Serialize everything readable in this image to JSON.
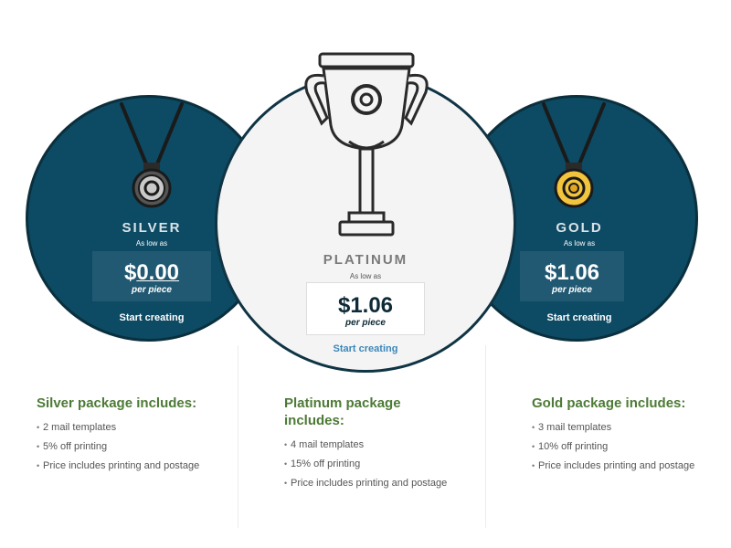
{
  "colors": {
    "side_circle": "#0d4a63",
    "center_circle": "#f5f4f4",
    "heading_green": "#4d7a36",
    "link_blue": "#3a87b9",
    "gold": "#f2c53c",
    "silver": "#c9c9c9"
  },
  "silver": {
    "name": "SILVER",
    "low": "As low as",
    "price_symbol": "$",
    "price_value": "0.00",
    "per": "per piece",
    "cta": "Start creating",
    "icon": "silver-medal-icon",
    "heading": "Silver package includes:",
    "features": [
      "2 mail templates",
      "5% off printing",
      "Price includes printing and postage"
    ]
  },
  "platinum": {
    "name": "PLATINUM",
    "low": "As low as",
    "price": "$1.06",
    "per": "per piece",
    "cta": "Start creating",
    "icon": "trophy-icon",
    "heading": "Platinum package includes:",
    "features": [
      "4 mail templates",
      "15% off printing",
      "Price includes printing and postage"
    ]
  },
  "gold": {
    "name": "GOLD",
    "low": "As low as",
    "price": "$1.06",
    "per": "per piece",
    "cta": "Start creating",
    "icon": "gold-medal-icon",
    "heading": "Gold package includes:",
    "features": [
      "3 mail templates",
      "10% off printing",
      "Price includes printing and postage"
    ]
  }
}
